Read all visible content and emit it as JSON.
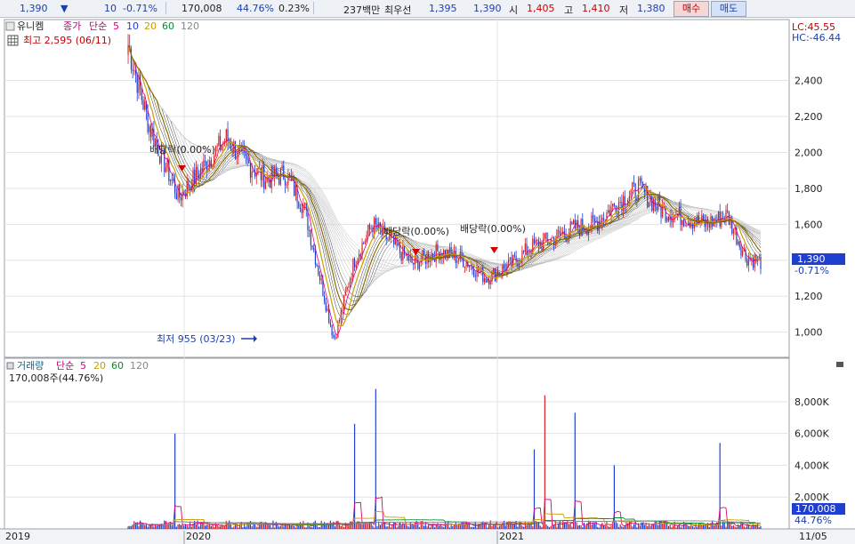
{
  "header": {
    "price": "1,390",
    "change_arrow": "▼",
    "change": "10",
    "change_pct": "-0.71%",
    "volume": "170,008",
    "volume_ratio": "44.76%",
    "turnover_pct": "0.23%",
    "trade_value": "237백만",
    "best_ask_label": "최우선",
    "best_ask": "1,395",
    "best_bid": "1,390",
    "open_label": "시",
    "open": "1,405",
    "high_label": "고",
    "high": "1,410",
    "low_label": "저",
    "low": "1,380",
    "buy_button": "매수",
    "sell_button": "매도"
  },
  "price_panel": {
    "stock_name": "유니켐",
    "legend": {
      "close_label": "종가",
      "ma_label": "단순",
      "periods": [
        "5",
        "10",
        "20",
        "60",
        "120"
      ]
    },
    "high_note": "최고 2,595 (06/11)",
    "low_note": "최저 955 (03/23)",
    "dividend_labels": [
      "배당락(0.00%)",
      "배당락(0.00%)",
      "배당락(0.00%)"
    ],
    "lc": "LC:45.55",
    "hc": "HC:-46.44",
    "current_price_tag": "1,390",
    "current_change_tag": "-0.71%"
  },
  "volume_panel": {
    "title": "거래량",
    "ma_label": "단순",
    "periods": [
      "5",
      "20",
      "60",
      "120"
    ],
    "current_text": "170,008주(44.76%)",
    "current_volume_tag": "170,008",
    "current_ratio_tag": "44.76%"
  },
  "x_axis": {
    "labels": [
      "2019",
      "2020",
      "2021",
      "11/05"
    ]
  },
  "colors": {
    "up": "#d42020",
    "down": "#1f3fd0",
    "ma5": "#e0007a",
    "ma10": "#1f3fd0",
    "ma20": "#c8a000",
    "ma60": "#0a8a2e",
    "ma120": "#888888",
    "grid": "#e3e3e3"
  },
  "chart_data": [
    {
      "type": "candlestick",
      "title": "유니켐",
      "y_ticks": [
        1000,
        1200,
        1400,
        1600,
        1800,
        2000,
        2200,
        2400
      ],
      "ylim": [
        860,
        2640
      ],
      "x_labels": [
        "2019",
        "2020",
        "2021",
        "11/05"
      ],
      "annotations": [
        {
          "text": "최고 2,595 (06/11)",
          "value": 2595
        },
        {
          "text": "최저 955 (03/23)",
          "value": 955
        }
      ],
      "trend": {
        "dates": [
          "2019-06-11",
          "2019-07-10",
          "2019-08-20",
          "2019-09-20",
          "2019-10-25",
          "2019-11-20",
          "2019-12-20",
          "2020-01-15",
          "2020-02-10",
          "2020-03-23",
          "2020-04-20",
          "2020-05-15",
          "2020-06-10",
          "2020-07-10",
          "2020-08-15",
          "2020-09-20",
          "2020-10-20",
          "2020-11-25",
          "2020-12-20",
          "2021-01-20",
          "2021-02-20",
          "2021-03-20",
          "2021-04-20",
          "2021-05-20",
          "2021-06-20",
          "2021-07-20",
          "2021-08-20",
          "2021-09-20",
          "2021-10-15",
          "2021-11-05"
        ],
        "close": [
          2595,
          2150,
          1750,
          1900,
          2080,
          1950,
          1850,
          1880,
          1700,
          955,
          1400,
          1600,
          1500,
          1380,
          1450,
          1400,
          1300,
          1380,
          1470,
          1520,
          1580,
          1600,
          1720,
          1800,
          1680,
          1640,
          1600,
          1650,
          1420,
          1390
        ]
      }
    },
    {
      "type": "bar",
      "title": "거래량",
      "y_ticks": [
        2000,
        4000,
        6000,
        8000
      ],
      "y_tick_labels": [
        "2,000K",
        "4,000K",
        "6,000K",
        "8,000K"
      ],
      "units": "K",
      "ylim": [
        0,
        9500
      ],
      "current": 170.008,
      "spikes": [
        {
          "date": "2019-08-15",
          "value": 6000
        },
        {
          "date": "2020-04-20",
          "value": 6600
        },
        {
          "date": "2020-05-20",
          "value": 8800
        },
        {
          "date": "2020-12-25",
          "value": 5000
        },
        {
          "date": "2021-01-10",
          "value": 8400
        },
        {
          "date": "2021-02-20",
          "value": 7300
        },
        {
          "date": "2021-04-15",
          "value": 4000
        },
        {
          "date": "2021-09-10",
          "value": 5400
        }
      ]
    }
  ]
}
